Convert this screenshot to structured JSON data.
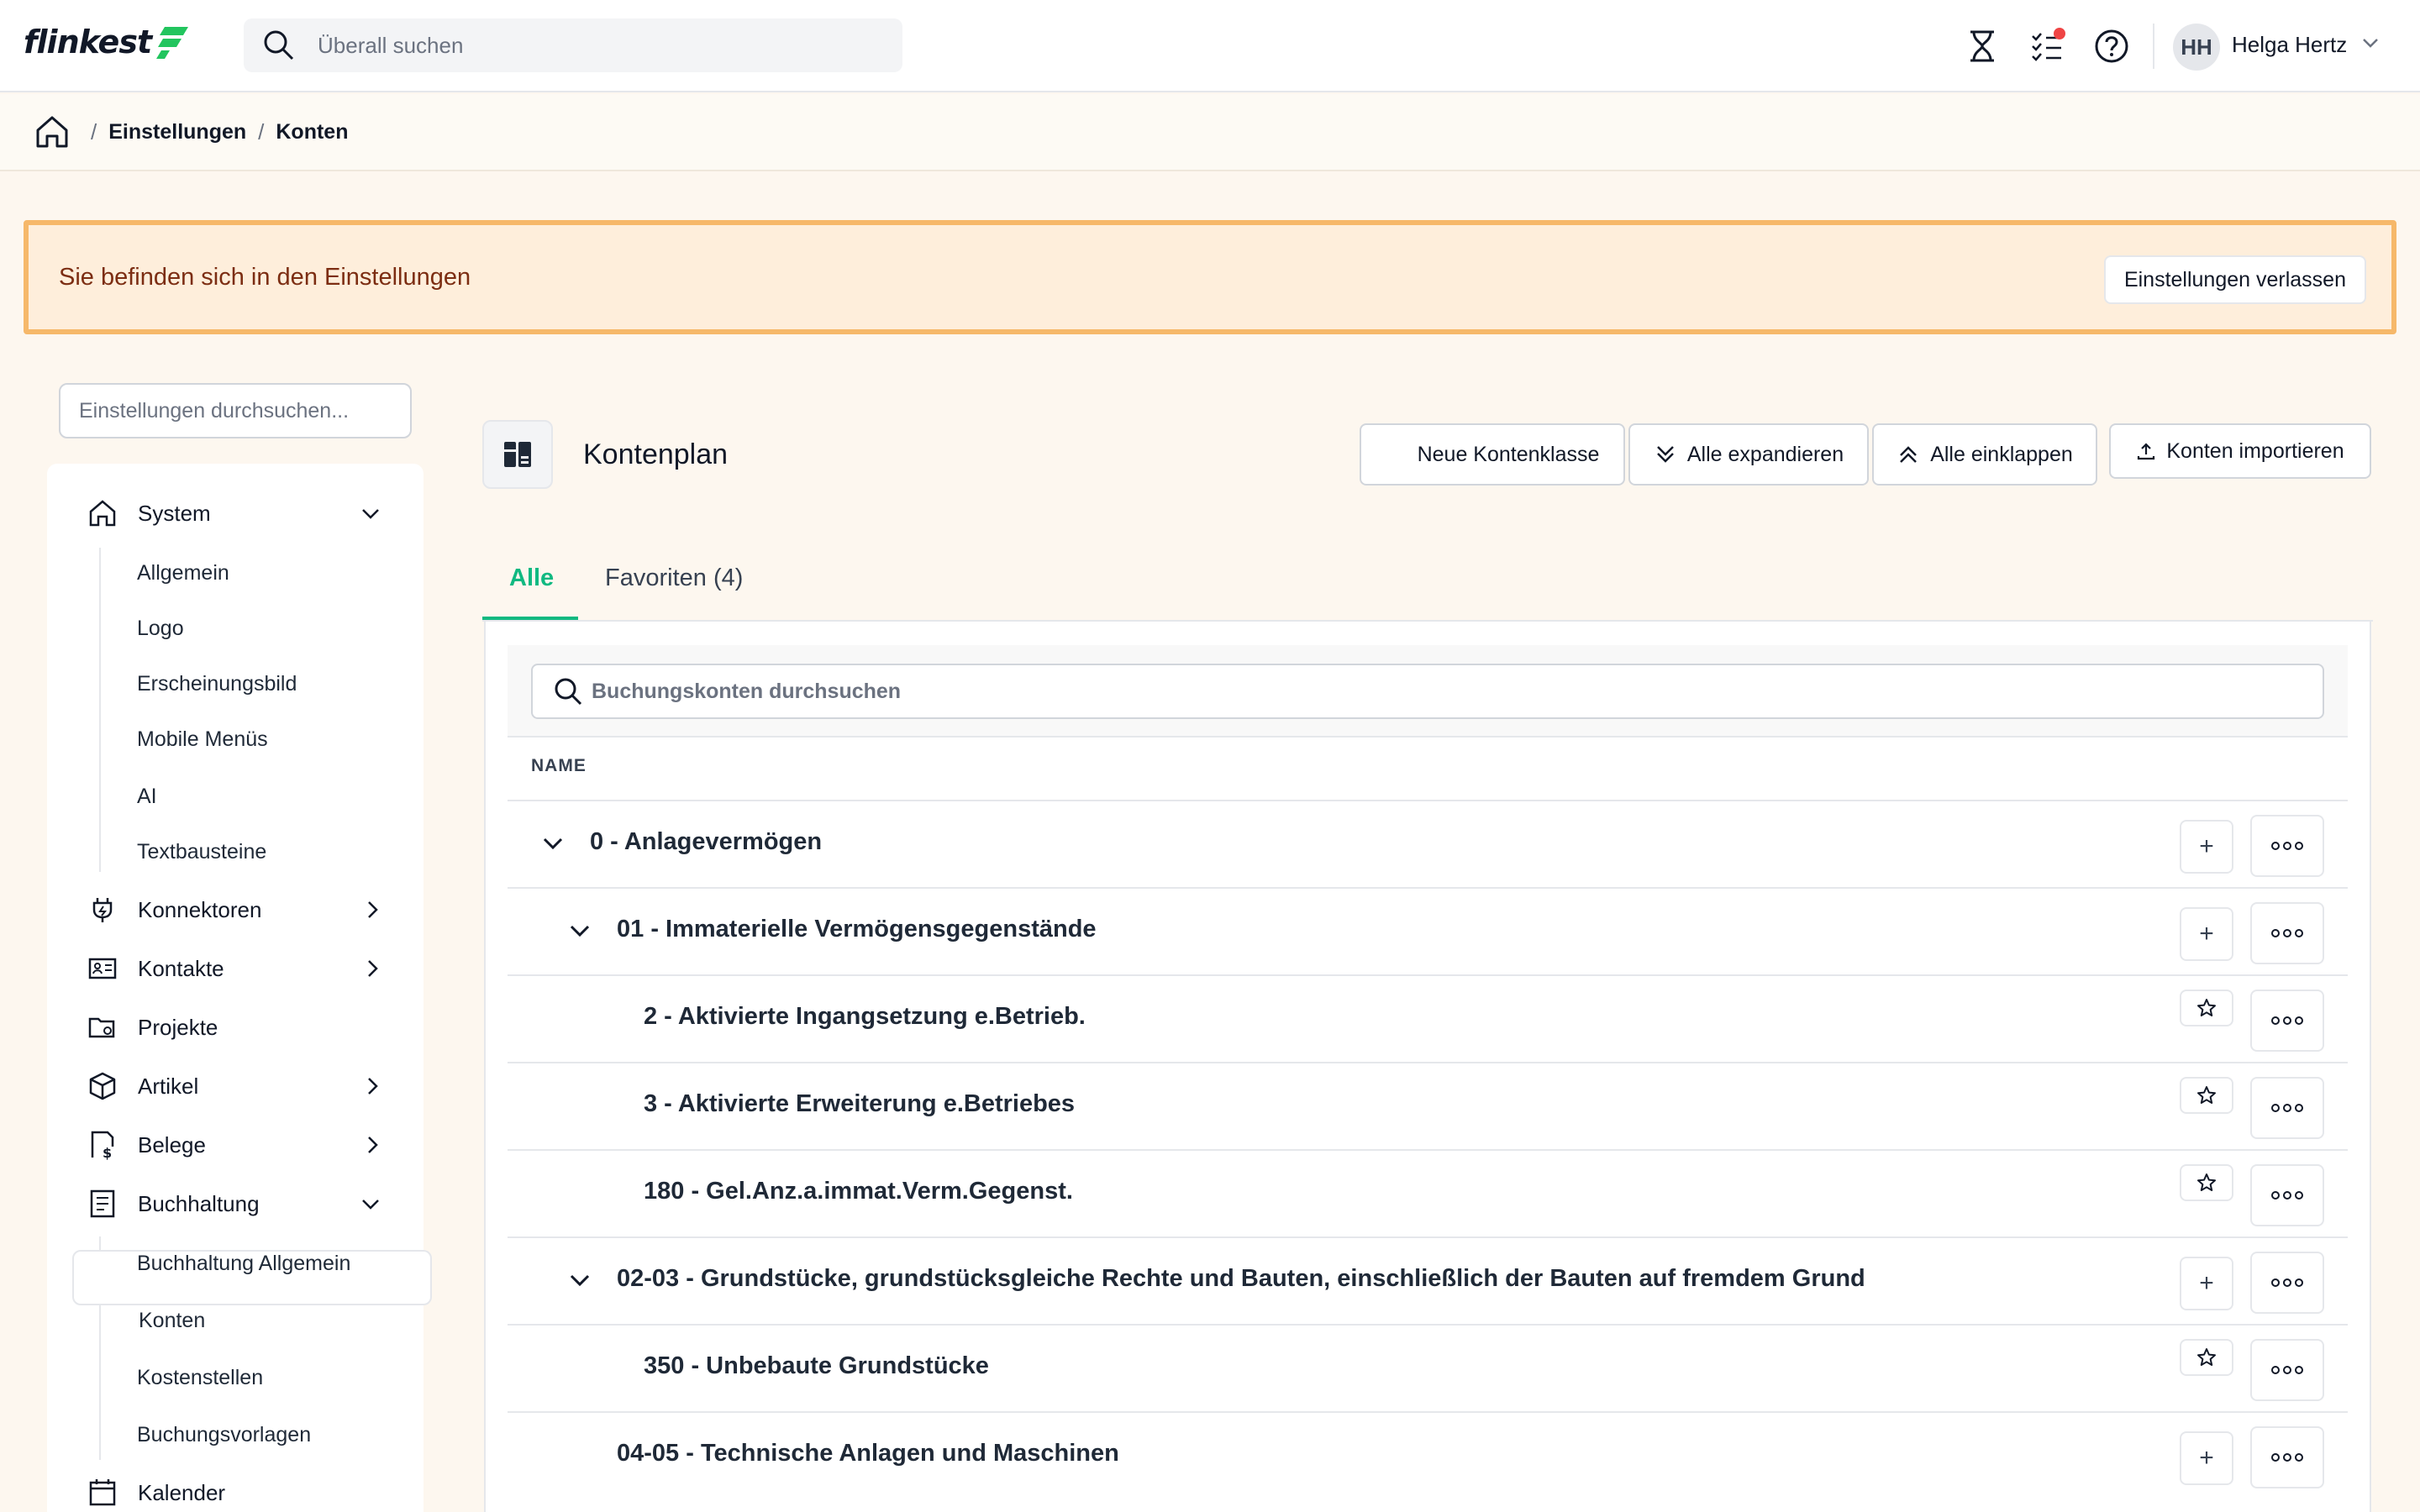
{
  "app": {
    "logo": "flinkest"
  },
  "search": {
    "placeholder": "Überall suchen"
  },
  "user": {
    "initials": "HH",
    "name": "Helga Hertz"
  },
  "icons": {
    "timer": "hourglass-icon",
    "tasks": "tasks-icon",
    "help": "help-icon",
    "notification_dot_color": "#ef4444"
  },
  "breadcrumb": {
    "items": [
      "Einstellungen",
      "Konten"
    ],
    "separator": "/"
  },
  "banner": {
    "text": "Sie befinden sich in den Einstellungen",
    "button": "Einstellungen verlassen"
  },
  "sidebar": {
    "search_placeholder": "Einstellungen durchsuchen...",
    "system": {
      "label": "System",
      "items": [
        "Allgemein",
        "Logo",
        "Erscheinungsbild",
        "Mobile Menüs",
        "AI",
        "Textbausteine"
      ]
    },
    "konnektoren": "Konnektoren",
    "kontakte": "Kontakte",
    "projekte": "Projekte",
    "artikel": "Artikel",
    "belege": "Belege",
    "buchhaltung": {
      "label": "Buchhaltung",
      "items": [
        "Buchhaltung Allgemein",
        "Konten",
        "Kostenstellen",
        "Buchungsvorlagen"
      ]
    },
    "kalender": "Kalender"
  },
  "page": {
    "title": "Kontenplan"
  },
  "toolbar": {
    "new_class": "Neue Kontenklasse",
    "expand_all": "Alle expandieren",
    "collapse_all": "Alle einklappen",
    "import": "Konten importieren"
  },
  "tabs": {
    "all": "Alle",
    "favorites": "Favoriten (4)"
  },
  "accounts": {
    "search_placeholder": "Buchungskonten durchsuchen",
    "column_name": "NAME",
    "rows": [
      {
        "name": "0 - Anlagevermögen",
        "level": 0,
        "expandable": true,
        "action": "plus"
      },
      {
        "name": "01 - Immaterielle Vermögensgegenstände",
        "level": 1,
        "expandable": true,
        "action": "plus"
      },
      {
        "name": "2 - Aktivierte Ingangsetzung e.Betrieb.",
        "level": 2,
        "expandable": false,
        "action": "star"
      },
      {
        "name": "3 - Aktivierte Erweiterung e.Betriebes",
        "level": 2,
        "expandable": false,
        "action": "star"
      },
      {
        "name": "180 - Gel.Anz.a.immat.Verm.Gegenst.",
        "level": 2,
        "expandable": false,
        "action": "star"
      },
      {
        "name": "02-03 - Grundstücke, grundstücksgleiche Rechte und Bauten, einschließlich der Bauten auf fremdem Grund",
        "level": 1,
        "expandable": true,
        "action": "plus"
      },
      {
        "name": "350 - Unbebaute Grundstücke",
        "level": 2,
        "expandable": false,
        "action": "star"
      },
      {
        "name": "04-05 - Technische Anlagen und Maschinen",
        "level": 1,
        "expandable": false,
        "action": "plus"
      }
    ]
  },
  "colors": {
    "accent": "#10b981",
    "banner_bg": "#feeedb",
    "banner_border": "#f6b86a",
    "logo_green": "#22c55e"
  }
}
